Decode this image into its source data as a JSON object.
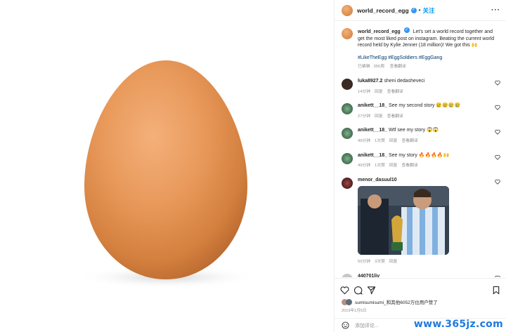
{
  "post": {
    "username": "world_record_egg",
    "dot": "•",
    "follow_label": "关注",
    "caption": "Let's set a world record together and get the most liked post on instagram. Beating the current world record held by Kylie Jenner (18 million)! We got this 🙌",
    "hashtags": "#LikeTheEgg #EggSoldiers #EggGang",
    "caption_meta": {
      "edited": "已编辑 · 356周",
      "translate": "查看翻译"
    }
  },
  "comments": [
    {
      "user": "luka8927.2",
      "text": "sheni dedasheveci",
      "time": "14分钟",
      "reply": "回复",
      "translate": "查看翻译"
    },
    {
      "user": "anikett__18_",
      "text": "See my second story 😢😢😢😢",
      "time": "27分钟",
      "reply": "回复",
      "translate": "查看翻译"
    },
    {
      "user": "anikett__18_",
      "text": "Wtf see my story 😱😱",
      "time": "49分钟",
      "likes": "1次赞",
      "reply": "回复",
      "translate": "查看翻译"
    },
    {
      "user": "anikett__18_",
      "text": "See my story 🔥🔥🔥🔥🙌",
      "time": "49分钟",
      "likes": "1次赞",
      "reply": "回复",
      "translate": "查看翻译"
    },
    {
      "user": "menor_dasuul10",
      "time": "50分钟",
      "likes": "3次赞",
      "reply": "回复"
    },
    {
      "user": "440701ljv"
    }
  ],
  "footer": {
    "likes_text": "sumisumisumi_和其他6052万位用户赞了",
    "date": "2019年1月5日",
    "add_comment_placeholder": "添加评论..."
  },
  "watermark": "www.365jz.com",
  "colors": {
    "accent": "#0095f6",
    "verified": "#3897f0",
    "hashtag": "#00376b",
    "egg": "#e29a5c"
  }
}
